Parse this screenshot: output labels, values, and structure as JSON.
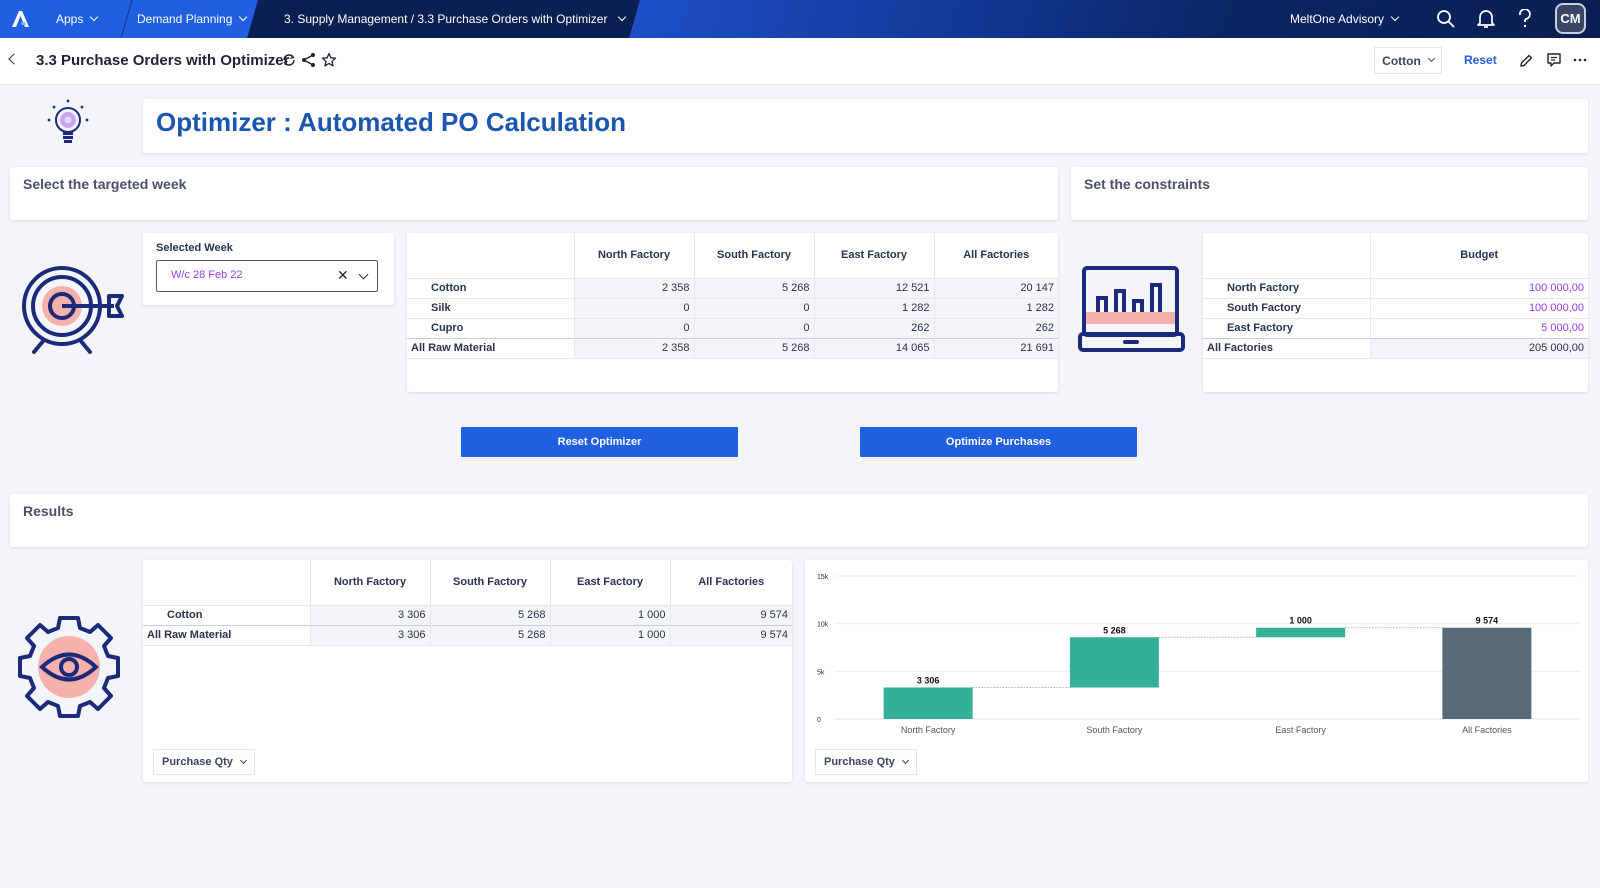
{
  "topnav": {
    "apps_label": "Apps",
    "demand_label": "Demand Planning",
    "breadcrumb_label": "3. Supply Management / 3.3 Purchase Orders with Optimizer",
    "workspace_label": "MeltOne Advisory",
    "avatar_initials": "CM"
  },
  "pagehead": {
    "title": "3.3 Purchase Orders with Optimizer",
    "filter_value": "Cotton",
    "reset_label": "Reset"
  },
  "banner": {
    "title": "Optimizer : Automated PO Calculation"
  },
  "sections": {
    "target_week": "Select the targeted week",
    "constraints": "Set the constraints",
    "results": "Results"
  },
  "selected_week": {
    "label": "Selected Week",
    "value": "W/c 28 Feb 22"
  },
  "demand_table": {
    "columns": [
      "",
      "North Factory",
      "South Factory",
      "East Factory",
      "All Factories"
    ],
    "rows": [
      {
        "label": "Cotton",
        "values": [
          "2 358",
          "5 268",
          "12 521",
          "20 147"
        ]
      },
      {
        "label": "Silk",
        "values": [
          "0",
          "0",
          "1 282",
          "1 282"
        ]
      },
      {
        "label": "Cupro",
        "values": [
          "0",
          "0",
          "262",
          "262"
        ]
      }
    ],
    "total": {
      "label": "All Raw Material",
      "values": [
        "2 358",
        "5 268",
        "14 065",
        "21 691"
      ]
    }
  },
  "budget_table": {
    "columns": [
      "",
      "Budget"
    ],
    "rows": [
      {
        "label": "North Factory",
        "value": "100 000,00"
      },
      {
        "label": "South Factory",
        "value": "100 000,00"
      },
      {
        "label": "East Factory",
        "value": "5 000,00"
      }
    ],
    "total": {
      "label": "All Factories",
      "value": "205 000,00"
    }
  },
  "buttons": {
    "reset_optimizer": "Reset Optimizer",
    "optimize_purchases": "Optimize Purchases"
  },
  "results_table": {
    "columns": [
      "",
      "North Factory",
      "South Factory",
      "East Factory",
      "All Factories"
    ],
    "rows": [
      {
        "label": "Cotton",
        "values": [
          "3 306",
          "5 268",
          "1 000",
          "9 574"
        ]
      }
    ],
    "total": {
      "label": "All Raw Material",
      "values": [
        "3 306",
        "5 268",
        "1 000",
        "9 574"
      ]
    },
    "measure_dropdown": "Purchase Qty"
  },
  "chart_panel": {
    "measure_dropdown": "Purchase Qty"
  },
  "colors": {
    "accent": "#1f5fe0",
    "increase": "#33b095",
    "total": "#586a7a",
    "input_value": "#9a3de6",
    "nav_dark": "#0a1f52"
  },
  "chart_data": {
    "type": "bar",
    "subtype": "waterfall",
    "title": "",
    "xlabel": "",
    "ylabel": "",
    "categories": [
      "North Factory",
      "South Factory",
      "East Factory",
      "All Factories"
    ],
    "values": [
      3306,
      5268,
      1000,
      9574
    ],
    "labels": [
      "3 306",
      "5 268",
      "1 000",
      "9 574"
    ],
    "is_total": [
      false,
      false,
      false,
      true
    ],
    "yticks": [
      0,
      5000,
      10000,
      15000
    ],
    "ytick_labels": [
      "0",
      "5k",
      "10k",
      "15k"
    ],
    "ylim": [
      0,
      15000
    ],
    "grid": true,
    "legend": "none"
  }
}
